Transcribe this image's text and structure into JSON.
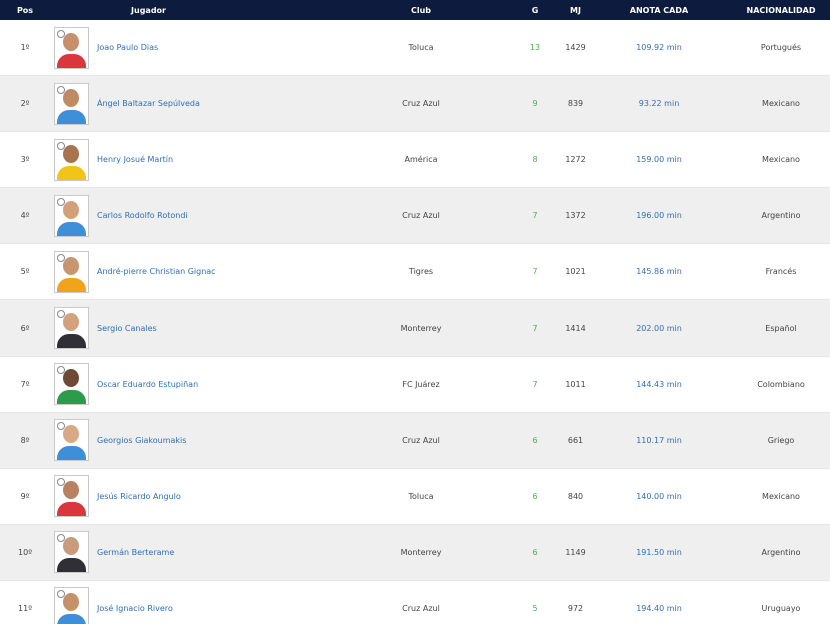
{
  "header": {
    "pos": "Pos",
    "jugador": "Jugador",
    "club": "Club",
    "g": "G",
    "mj": "MJ",
    "anota": "ANOTA CADA",
    "nacionalidad": "NACIONALIDAD"
  },
  "rows": [
    {
      "pos": "1º",
      "name": "Joao Paulo Dias",
      "club": "Toluca",
      "g": "13",
      "mj": "1429",
      "anota": "109.92 min",
      "nac": "Portugués",
      "skin": "#c98e6c",
      "shirt": "#d9363e"
    },
    {
      "pos": "2º",
      "name": "Ángel Baltazar Sepúlveda",
      "club": "Cruz Azul",
      "g": "9",
      "mj": "839",
      "anota": "93.22 min",
      "nac": "Mexicano",
      "skin": "#c08a64",
      "shirt": "#3f8ed8"
    },
    {
      "pos": "3º",
      "name": "Henry Josué Martín",
      "club": "América",
      "g": "8",
      "mj": "1272",
      "anota": "159.00 min",
      "nac": "Mexicano",
      "skin": "#a8734e",
      "shirt": "#f2c417"
    },
    {
      "pos": "4º",
      "name": "Carlos Rodolfo Rotondi",
      "club": "Cruz Azul",
      "g": "7",
      "mj": "1372",
      "anota": "196.00 min",
      "nac": "Argentino",
      "skin": "#d4a07c",
      "shirt": "#3f8ed8"
    },
    {
      "pos": "5º",
      "name": "André-pierre Christian Gignac",
      "club": "Tigres",
      "g": "7",
      "mj": "1021",
      "anota": "145.86 min",
      "nac": "Francés",
      "skin": "#c99570",
      "shirt": "#f0a31b"
    },
    {
      "pos": "6º",
      "name": "Sergio Canales",
      "club": "Monterrey",
      "g": "7",
      "mj": "1414",
      "anota": "202.00 min",
      "nac": "Español",
      "skin": "#d3a17e",
      "shirt": "#2f2f35"
    },
    {
      "pos": "7º",
      "name": "Oscar Eduardo Estupiñan",
      "club": "FC Juárez",
      "g": "7",
      "mj": "1011",
      "anota": "144.43 min",
      "nac": "Colombiano",
      "skin": "#6e4a33",
      "shirt": "#2e9b4b"
    },
    {
      "pos": "8º",
      "name": "Georgios Giakoumakis",
      "club": "Cruz Azul",
      "g": "6",
      "mj": "661",
      "anota": "110.17 min",
      "nac": "Griego",
      "skin": "#d7a987",
      "shirt": "#3f8ed8"
    },
    {
      "pos": "9º",
      "name": "Jesús Ricardo Angulo",
      "club": "Toluca",
      "g": "6",
      "mj": "840",
      "anota": "140.00 min",
      "nac": "Mexicano",
      "skin": "#b98062",
      "shirt": "#d9363e"
    },
    {
      "pos": "10º",
      "name": "Germán Berterame",
      "club": "Monterrey",
      "g": "6",
      "mj": "1149",
      "anota": "191.50 min",
      "nac": "Argentino",
      "skin": "#c79b7c",
      "shirt": "#2f2f35"
    },
    {
      "pos": "11º",
      "name": "José Ignacio Rivero",
      "club": "Cruz Azul",
      "g": "5",
      "mj": "972",
      "anota": "194.40 min",
      "nac": "Uruguayo",
      "skin": "#c5906a",
      "shirt": "#3f8ed8"
    }
  ]
}
